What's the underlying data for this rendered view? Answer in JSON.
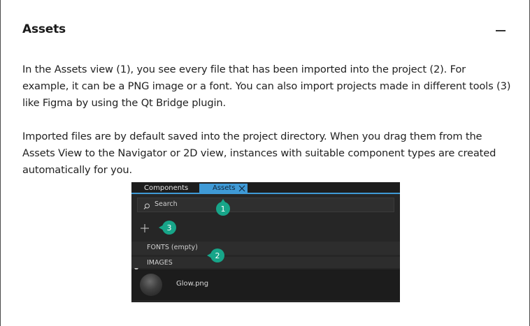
{
  "section": {
    "title": "Assets",
    "collapse_icon": "minus-icon"
  },
  "paragraphs": [
    "In the Assets view (1), you see every file that has been imported into the project (2). For example, it can be a PNG image or a font. You can also import projects made in different tools (3) like Figma by using the Qt Bridge plugin.",
    "Imported files are by default saved into the project directory. When you drag them from the Assets View to the Navigator or 2D view, instances with suitable component types are created automatically for you."
  ],
  "screenshot": {
    "tabs": [
      {
        "label": "Components",
        "active": false
      },
      {
        "label": "Assets",
        "active": true
      }
    ],
    "search_placeholder": "Search",
    "add_icon": "plus-icon",
    "sections": [
      {
        "label": "FONTS (empty)"
      },
      {
        "label": "IMAGES",
        "expanded": true
      }
    ],
    "assets": [
      {
        "name": "Glow.png"
      }
    ],
    "callouts": [
      "1",
      "2",
      "3"
    ],
    "colors": {
      "accent": "#3f9ad6",
      "callout": "#17a589",
      "panel_bg": "#262626"
    }
  }
}
